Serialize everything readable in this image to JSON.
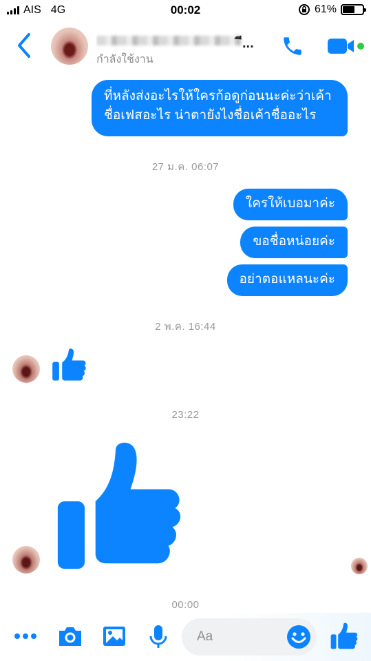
{
  "status_bar": {
    "carrier": "AIS",
    "network": "4G",
    "time": "00:02",
    "battery": "61%",
    "battery_level": 0.61
  },
  "header": {
    "contact_name_suffix": "ี...",
    "contact_status": "กำลังใช้งาน",
    "online_color": "#2ecc40"
  },
  "accent_color": "#0d84ff",
  "messages": {
    "first_line1": "ที่หลังส่งอะไรให้ใครก้อดูก่อนนะค่ะว่าเค้า",
    "first_line2": "ชื่อเฟสอะไร น่าตายังไงชื่อเค้าชื่ออะไร",
    "timestamp1": "27 ม.ค. 06:07",
    "sent2": "ใครให้เบอมาค่ะ",
    "sent3": "ขอชื่อหน่อยค่ะ",
    "sent4": "อย่าตอแหลนะค่ะ",
    "timestamp2": "2 พ.ค. 16:44",
    "timestamp3": "23:22",
    "timestamp4": "00:00"
  },
  "composer": {
    "placeholder": "Aa",
    "icons": [
      "more-icon",
      "camera-icon",
      "photo-icon",
      "mic-icon",
      "emoji-icon",
      "like-icon"
    ]
  }
}
